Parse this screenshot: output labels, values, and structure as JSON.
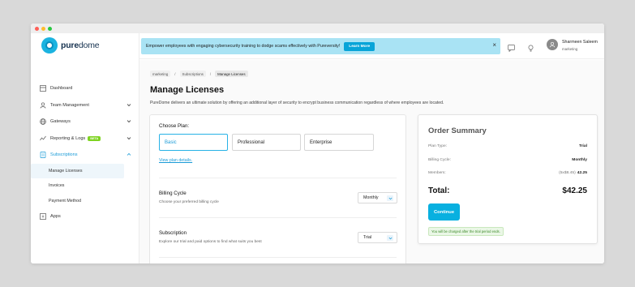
{
  "window": {
    "controls": {
      "close_color": "#ff5f57",
      "minimize_color": "#febc2e",
      "maximize_color": "#28c840"
    }
  },
  "brand": {
    "logo_bold": "pure",
    "logo_light": "dome",
    "accent": "#1bb3e0"
  },
  "sidebar": {
    "items": [
      {
        "label": "Dashboard",
        "icon": "dashboard-icon"
      },
      {
        "label": "Team Management",
        "icon": "user-icon"
      },
      {
        "label": "Gateways",
        "icon": "globe-icon"
      },
      {
        "label": "Reporting & Logs",
        "icon": "chart-icon",
        "badge": "BETA"
      },
      {
        "label": "Subscriptions",
        "icon": "subscription-icon",
        "expanded": true
      },
      {
        "label": "Apps",
        "icon": "apps-icon"
      }
    ],
    "sub_items": [
      {
        "label": "Manage Licenses",
        "selected": true
      },
      {
        "label": "Invoices"
      },
      {
        "label": "Payment Method"
      }
    ]
  },
  "banner": {
    "text": "Empower employees with engaging cybersecurity training to dodge scams effectively with Pureversity!",
    "button": "Learn More",
    "close": "×",
    "bg_color": "#a9e3f4"
  },
  "user": {
    "name": "Sharmeen Saleem",
    "role": "marketing"
  },
  "breadcrumb": {
    "items": [
      "marketing",
      "Subscriptions",
      "Manage Licenses"
    ],
    "separator": "/"
  },
  "page": {
    "title": "Manage Licenses",
    "description": "PureDome delivers an ultimate solution by offering an additional layer of security to encrypt business communication regardless of where employees are located."
  },
  "plan_form": {
    "choose_label": "Choose Plan:",
    "plans": [
      "Basic",
      "Professional",
      "Enterprise"
    ],
    "selected_plan": "Basic",
    "details_link": "View plan details.",
    "billing": {
      "label": "Billing Cycle",
      "sub": "Choose your preferred billing cycle",
      "value": "Monthly"
    },
    "subscription": {
      "label": "Subscription",
      "sub": "Explore our trial and paid options to find what suits you best",
      "value": "Trial"
    }
  },
  "summary": {
    "title": "Order Summary",
    "plan_type_label": "Plan Type:",
    "plan_type_value": "Trial",
    "billing_label": "Billing Cycle:",
    "billing_value": "Monthly",
    "members_label": "Members:",
    "members_prefix": "(5x$8.45)",
    "members_value": "42.25",
    "total_label": "Total:",
    "total_value": "$42.25",
    "continue": "Continue",
    "note": "You will be charged after the trial period ends."
  }
}
